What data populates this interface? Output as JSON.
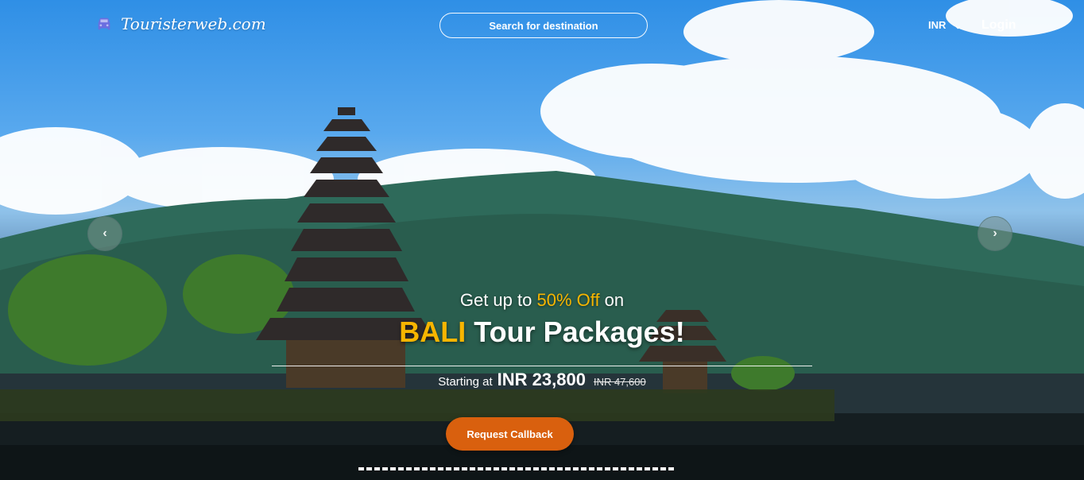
{
  "header": {
    "logo_text": "Touristerweb.com",
    "search_label": "Search for destination",
    "currency": "INR",
    "login_label": "Login"
  },
  "hero": {
    "promo_prefix": "Get up to ",
    "promo_discount": "50% Off",
    "promo_suffix": " on",
    "destination": "BALI",
    "packages_label": " Tour Packages!",
    "starting_at": "Starting at",
    "price": "INR 23,800",
    "old_price": "INR 47,600",
    "cta_label": "Request Callback",
    "prev_arrow": "‹",
    "next_arrow": "›"
  },
  "icons": {
    "logo": "car-icon",
    "currency": "chevron-down-icon",
    "prev": "chevron-left-icon",
    "next": "chevron-right-icon"
  },
  "colors": {
    "accent": "#f7b500",
    "cta": "#d9600e",
    "logo_icon": "#6b6ee0"
  },
  "slider": {
    "indicator_count": 40
  }
}
